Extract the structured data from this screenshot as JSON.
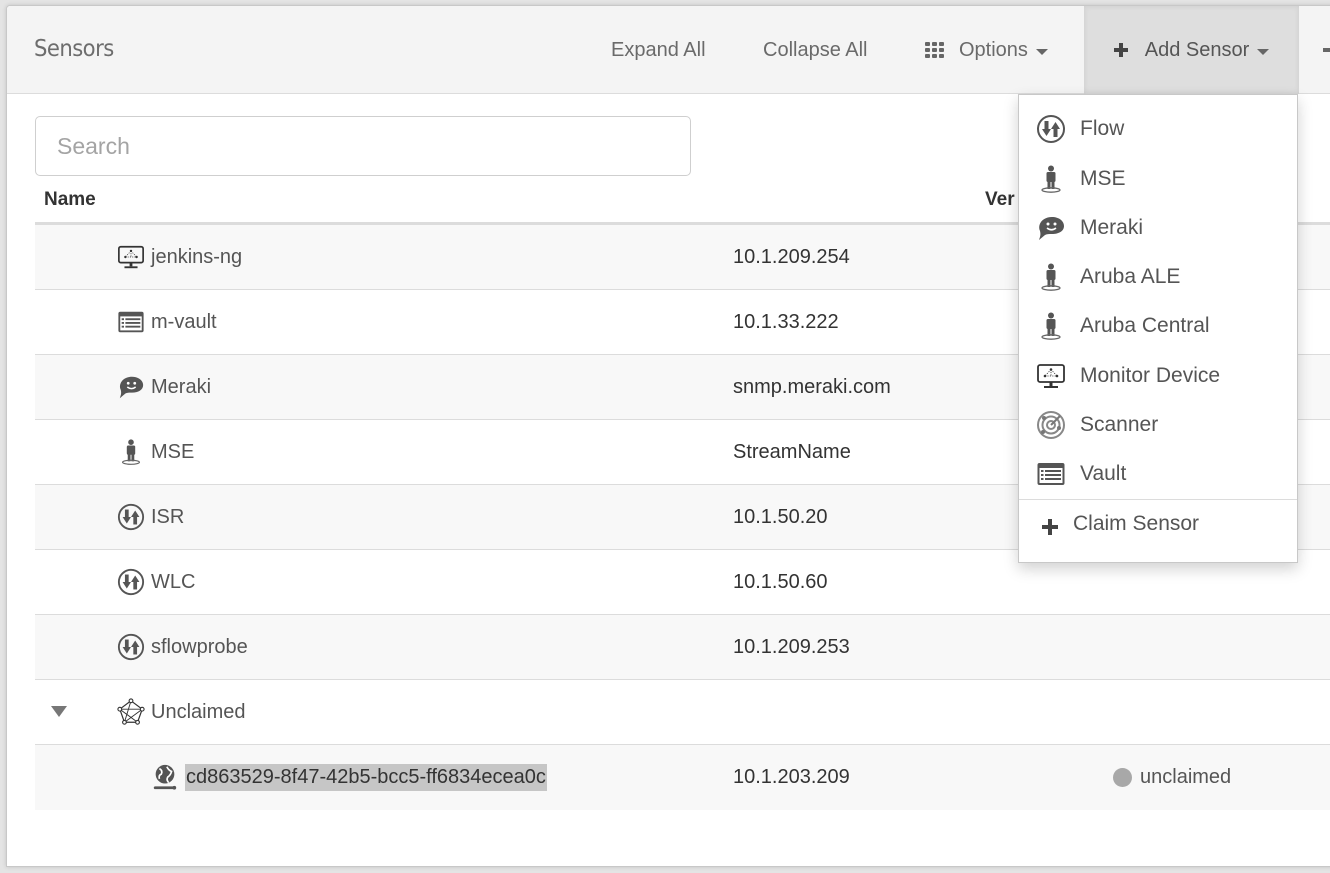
{
  "header": {
    "title": "Sensors",
    "expand_all": "Expand All",
    "collapse_all": "Collapse All",
    "options": "Options",
    "add_sensor": "Add Sensor"
  },
  "search": {
    "placeholder": "Search",
    "value": ""
  },
  "table": {
    "columns": [
      "Name",
      "Ver"
    ],
    "rows": [
      {
        "icon": "monitor-device-icon",
        "name": "jenkins-ng",
        "address": "10.1.209.254",
        "status": ""
      },
      {
        "icon": "vault-icon",
        "name": "m-vault",
        "address": "10.1.33.222",
        "status": ""
      },
      {
        "icon": "meraki-icon",
        "name": "Meraki",
        "address": "snmp.meraki.com",
        "status": ""
      },
      {
        "icon": "mse-person-icon",
        "name": "MSE",
        "address": "StreamName",
        "status": ""
      },
      {
        "icon": "flow-icon",
        "name": "ISR",
        "address": "10.1.50.20",
        "status": ""
      },
      {
        "icon": "flow-icon",
        "name": "WLC",
        "address": "10.1.50.60",
        "status": ""
      },
      {
        "icon": "flow-icon",
        "name": "sflowprobe",
        "address": "10.1.209.253",
        "status": ""
      },
      {
        "icon": "network-group-icon",
        "name": "Unclaimed",
        "address": "",
        "status": "",
        "expanded": true
      },
      {
        "icon": "globe-sensor-icon",
        "name": "cd863529-8f47-42b5-bcc5-ff6834ecea0c",
        "address": "10.1.203.209",
        "status": "unclaimed",
        "status_color": "#a8a8a8"
      }
    ]
  },
  "add_sensor_menu": {
    "items": [
      {
        "icon": "flow-icon",
        "label": "Flow"
      },
      {
        "icon": "mse-person-icon",
        "label": "MSE"
      },
      {
        "icon": "meraki-icon",
        "label": "Meraki"
      },
      {
        "icon": "aruba-person-icon",
        "label": "Aruba ALE"
      },
      {
        "icon": "aruba-person-icon",
        "label": "Aruba Central"
      },
      {
        "icon": "monitor-device-icon",
        "label": "Monitor Device"
      },
      {
        "icon": "scanner-radar-icon",
        "label": "Scanner"
      },
      {
        "icon": "vault-icon",
        "label": "Vault"
      }
    ],
    "claim_sensor": "Claim Sensor"
  }
}
